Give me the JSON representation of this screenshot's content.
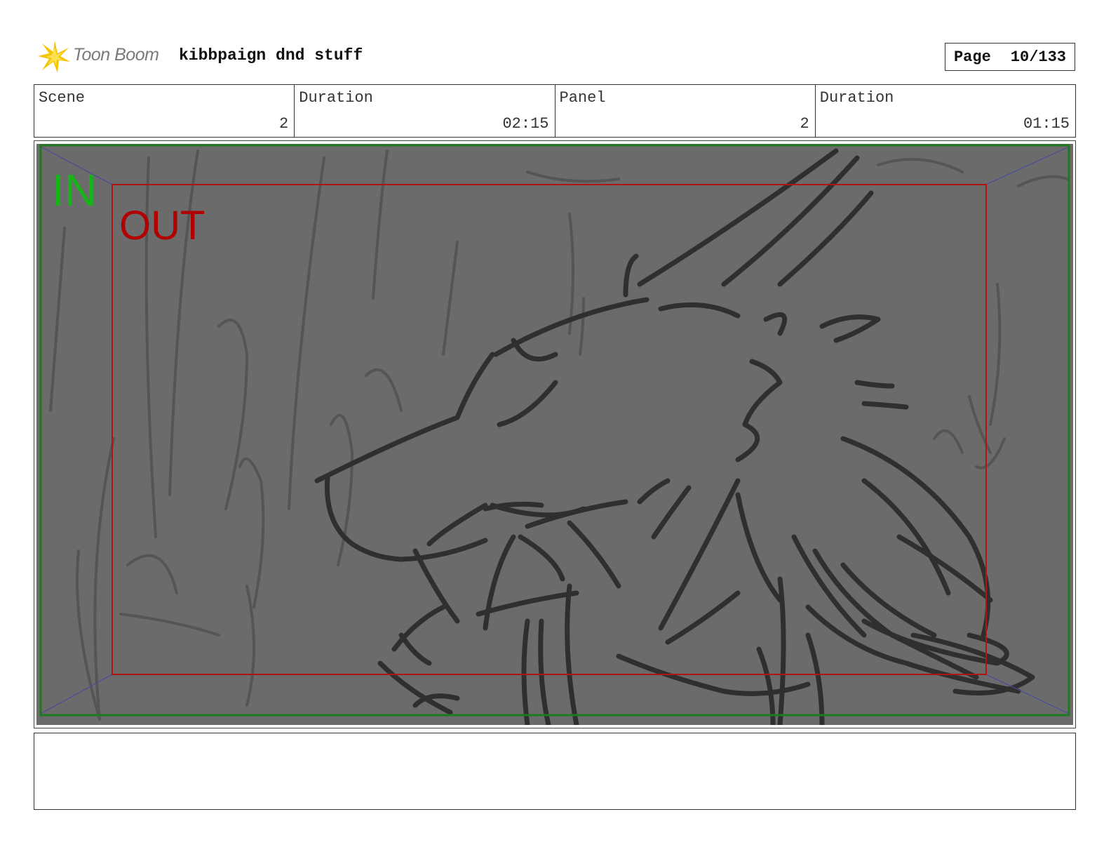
{
  "header": {
    "logo_text": "Toon Boom",
    "project_title": "kibbpaign dnd stuff",
    "page_label": "Page",
    "page_number": "10/133"
  },
  "info": {
    "scene_label": "Scene",
    "scene_value": "2",
    "scene_duration_label": "Duration",
    "scene_duration_value": "02:15",
    "panel_label": "Panel",
    "panel_value": "2",
    "panel_duration_label": "Duration",
    "panel_duration_value": "01:15"
  },
  "panel": {
    "in_label": "IN",
    "out_label": "OUT",
    "colors": {
      "background": "#6b6b6b",
      "in_frame": "#1f7a1f",
      "in_text": "#16b416",
      "out_frame": "#b01515",
      "out_text": "#b20000",
      "guide": "#4a4aa0",
      "sketch": "#2f2f2f"
    }
  },
  "notes": {
    "text": ""
  }
}
